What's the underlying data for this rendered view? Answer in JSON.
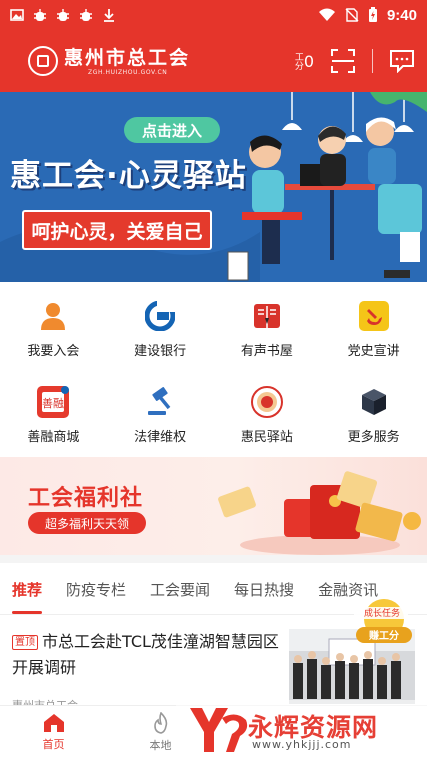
{
  "status_bar": {
    "time": "9:40",
    "icons": [
      "image-icon",
      "bug-icon",
      "bug-icon",
      "bug-icon",
      "download-icon"
    ],
    "right_icons": [
      "wifi-icon",
      "no-sim-icon",
      "battery-icon"
    ]
  },
  "header": {
    "title": "惠州市总工会",
    "url": "ZGH.HUIZHOU.GOV.CN",
    "score_unit": "工分",
    "score_value": "0",
    "scan_icon": "scan-icon",
    "message_icon": "message-icon"
  },
  "banner": {
    "enter_label": "点击进入",
    "title": "惠工会·心灵驿站",
    "slogan": "呵护心灵，关爱自己",
    "bg_color": "#2a6ab5"
  },
  "grid": {
    "items": [
      {
        "label": "我要入会",
        "icon": "person-icon"
      },
      {
        "label": "建设银行",
        "icon": "ccb-icon"
      },
      {
        "label": "有声书屋",
        "icon": "book-icon"
      },
      {
        "label": "党史宣讲",
        "icon": "party-emblem-icon"
      },
      {
        "label": "善融商城",
        "icon": "mall-icon"
      },
      {
        "label": "法律维权",
        "icon": "gavel-icon"
      },
      {
        "label": "惠民驿站",
        "icon": "station-seal-icon"
      },
      {
        "label": "更多服务",
        "icon": "cube-icon"
      }
    ]
  },
  "welfare": {
    "title": "工会福利社",
    "subtitle": "超多福利天天领"
  },
  "tabs": [
    {
      "label": "推荐",
      "active": true
    },
    {
      "label": "防疫专栏",
      "active": false
    },
    {
      "label": "工会要闻",
      "active": false
    },
    {
      "label": "每日热搜",
      "active": false
    },
    {
      "label": "金融资讯",
      "active": false
    }
  ],
  "news": {
    "tag": "置顶",
    "title": "市总工会赴TCL茂佳潼湖智慧园区开展调研",
    "meta": "惠州市总工会"
  },
  "task_badge": {
    "top": "成长任务",
    "bottom": "赚工分"
  },
  "bottom_nav": [
    {
      "label": "首页",
      "icon": "home-icon",
      "active": true
    },
    {
      "label": "本地",
      "icon": "flame-icon",
      "active": false
    }
  ],
  "watermark": {
    "name": "永辉资源网",
    "url": "www.yhkjjj.com"
  },
  "colors": {
    "brand_red": "#e5352b",
    "banner_blue": "#2a6ab5"
  }
}
